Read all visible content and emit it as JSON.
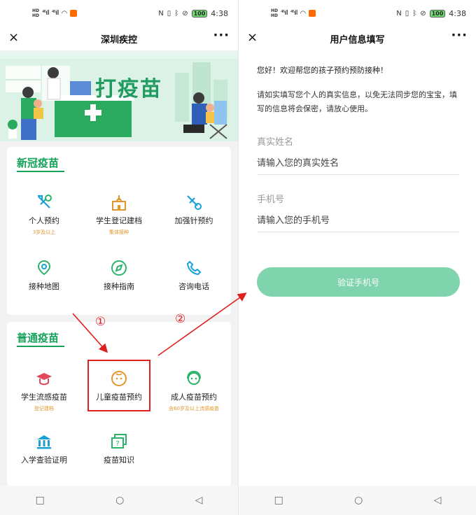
{
  "status": {
    "hd_top": "HD",
    "hd_bottom": "HD",
    "signal1": "⁴⁶ıll",
    "signal2": "⁴⁶ıll",
    "wifi": "◠",
    "battery": "100",
    "time": "4:38"
  },
  "left": {
    "nav": {
      "close": "×",
      "title": "深圳疾控",
      "more": "···"
    },
    "banner": {
      "title": "打疫苗"
    },
    "covid_card": {
      "title": "新冠疫苗",
      "items": [
        {
          "label": "个人预约",
          "sub": "3岁及以上",
          "icon": "syringe-icon"
        },
        {
          "label": "学生登记建档",
          "sub": "集体接种",
          "icon": "school-icon"
        },
        {
          "label": "加强针预约",
          "sub": "",
          "icon": "booster-syringe-icon"
        },
        {
          "label": "接种地图",
          "sub": "",
          "icon": "map-pin-icon"
        },
        {
          "label": "接种指南",
          "sub": "",
          "icon": "compass-icon"
        },
        {
          "label": "咨询电话",
          "sub": "",
          "icon": "phone-icon"
        }
      ]
    },
    "general_card": {
      "title": "普通疫苗",
      "items": [
        {
          "label": "学生流感疫苗",
          "sub": "登记建档",
          "icon": "graduation-cap-icon"
        },
        {
          "label": "儿童疫苗预约",
          "sub": "",
          "icon": "baby-face-icon"
        },
        {
          "label": "成人疫苗预约",
          "sub": "含60岁及以上流感疫苗",
          "icon": "adult-face-icon"
        },
        {
          "label": "入学查验证明",
          "sub": "",
          "icon": "building-icon"
        },
        {
          "label": "疫苗知识",
          "sub": "",
          "icon": "question-board-icon"
        }
      ]
    },
    "markers": {
      "one": "①",
      "two": "②"
    },
    "bottom": {
      "square": "□",
      "circle": "○",
      "back": "◁"
    }
  },
  "right": {
    "nav": {
      "close": "×",
      "title": "用户信息填写",
      "more": "···"
    },
    "greeting": "您好！欢迎帮您的孩子预约预防接种！",
    "notice": "请如实填写您个人的真实信息，以免无法同步您的宝宝，填写的信息将会保密，请放心使用。",
    "name_label": "真实姓名",
    "name_placeholder": "请输入您的真实姓名",
    "phone_label": "手机号",
    "phone_placeholder": "请输入您的手机号",
    "verify_button": "验证手机号",
    "bottom": {
      "square": "□",
      "circle": "○",
      "back": "◁"
    }
  },
  "colors": {
    "green": "#15a35c",
    "orange": "#e2952a",
    "red": "#e02020",
    "button": "#7fd3ad"
  }
}
